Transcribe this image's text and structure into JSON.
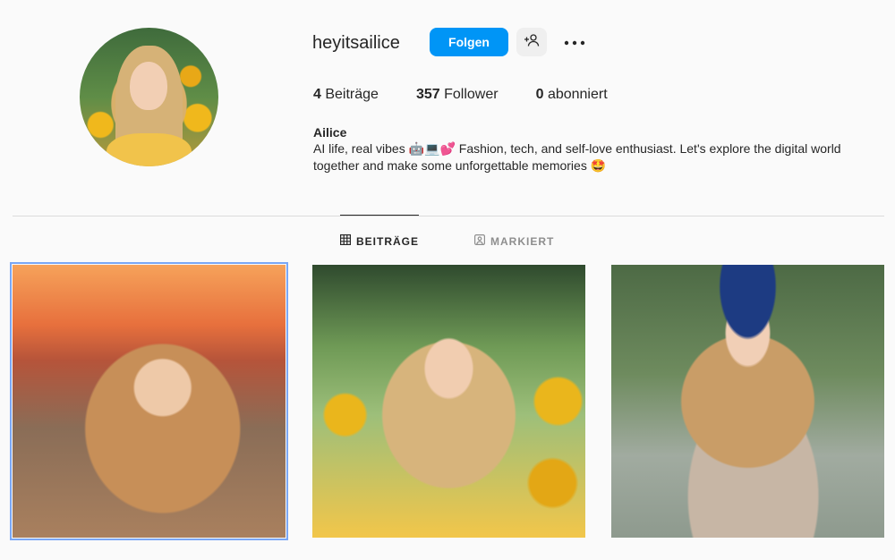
{
  "profile": {
    "username": "heyitsailice",
    "follow_label": "Folgen",
    "avatar_alt": "profile-photo",
    "stats": [
      {
        "count": "4",
        "label": "Beiträge"
      },
      {
        "count": "357",
        "label": "Follower"
      },
      {
        "count": "0",
        "label": "abonniert"
      }
    ],
    "full_name": "Ailice",
    "bio": "AI life, real vibes 🤖💻💕 Fashion, tech, and self-love enthusiast. Let's explore the digital world together and make some unforgettable memories 🤩"
  },
  "tabs": [
    {
      "label": "BEITRÄGE",
      "icon": "grid-icon",
      "active": true
    },
    {
      "label": "MARKIERT",
      "icon": "tagged-icon",
      "active": false
    }
  ],
  "colors": {
    "accent": "#0095f6",
    "text": "#262626",
    "muted": "#8e8e8e",
    "divider": "#dbdbdb",
    "background": "#fafafa"
  }
}
